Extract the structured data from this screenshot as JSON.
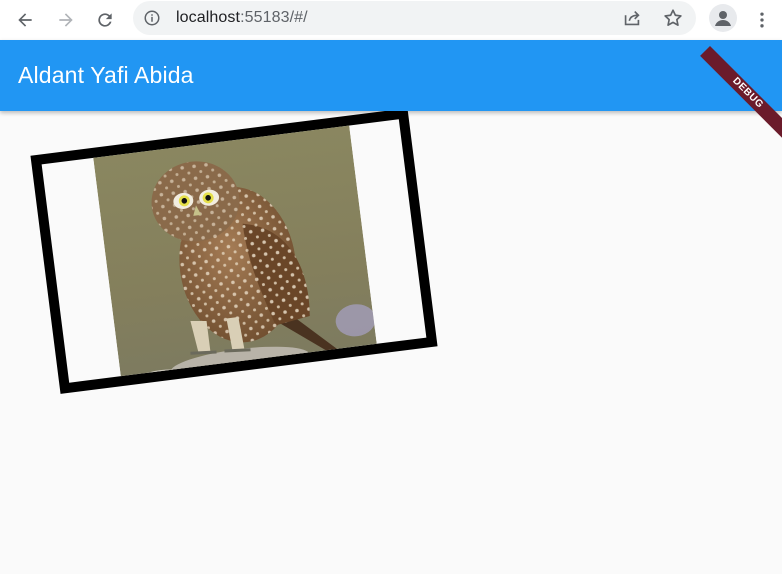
{
  "browser": {
    "url_host": "localhost",
    "url_rest": ":55183/#/",
    "icons": {
      "back": "arrow-left-icon",
      "forward": "arrow-right-icon",
      "reload": "reload-icon",
      "site_info": "info-icon",
      "share": "share-icon",
      "bookmark": "star-icon",
      "profile": "person-icon",
      "menu": "kebab-menu-icon"
    }
  },
  "app": {
    "title": "Aldant Yafi Abida",
    "debug_banner": "DEBUG",
    "appbar_color": "#2196f3",
    "banner_color": "#6b1b2b"
  },
  "content": {
    "image_subject": "owl",
    "frame_color": "#000000"
  }
}
